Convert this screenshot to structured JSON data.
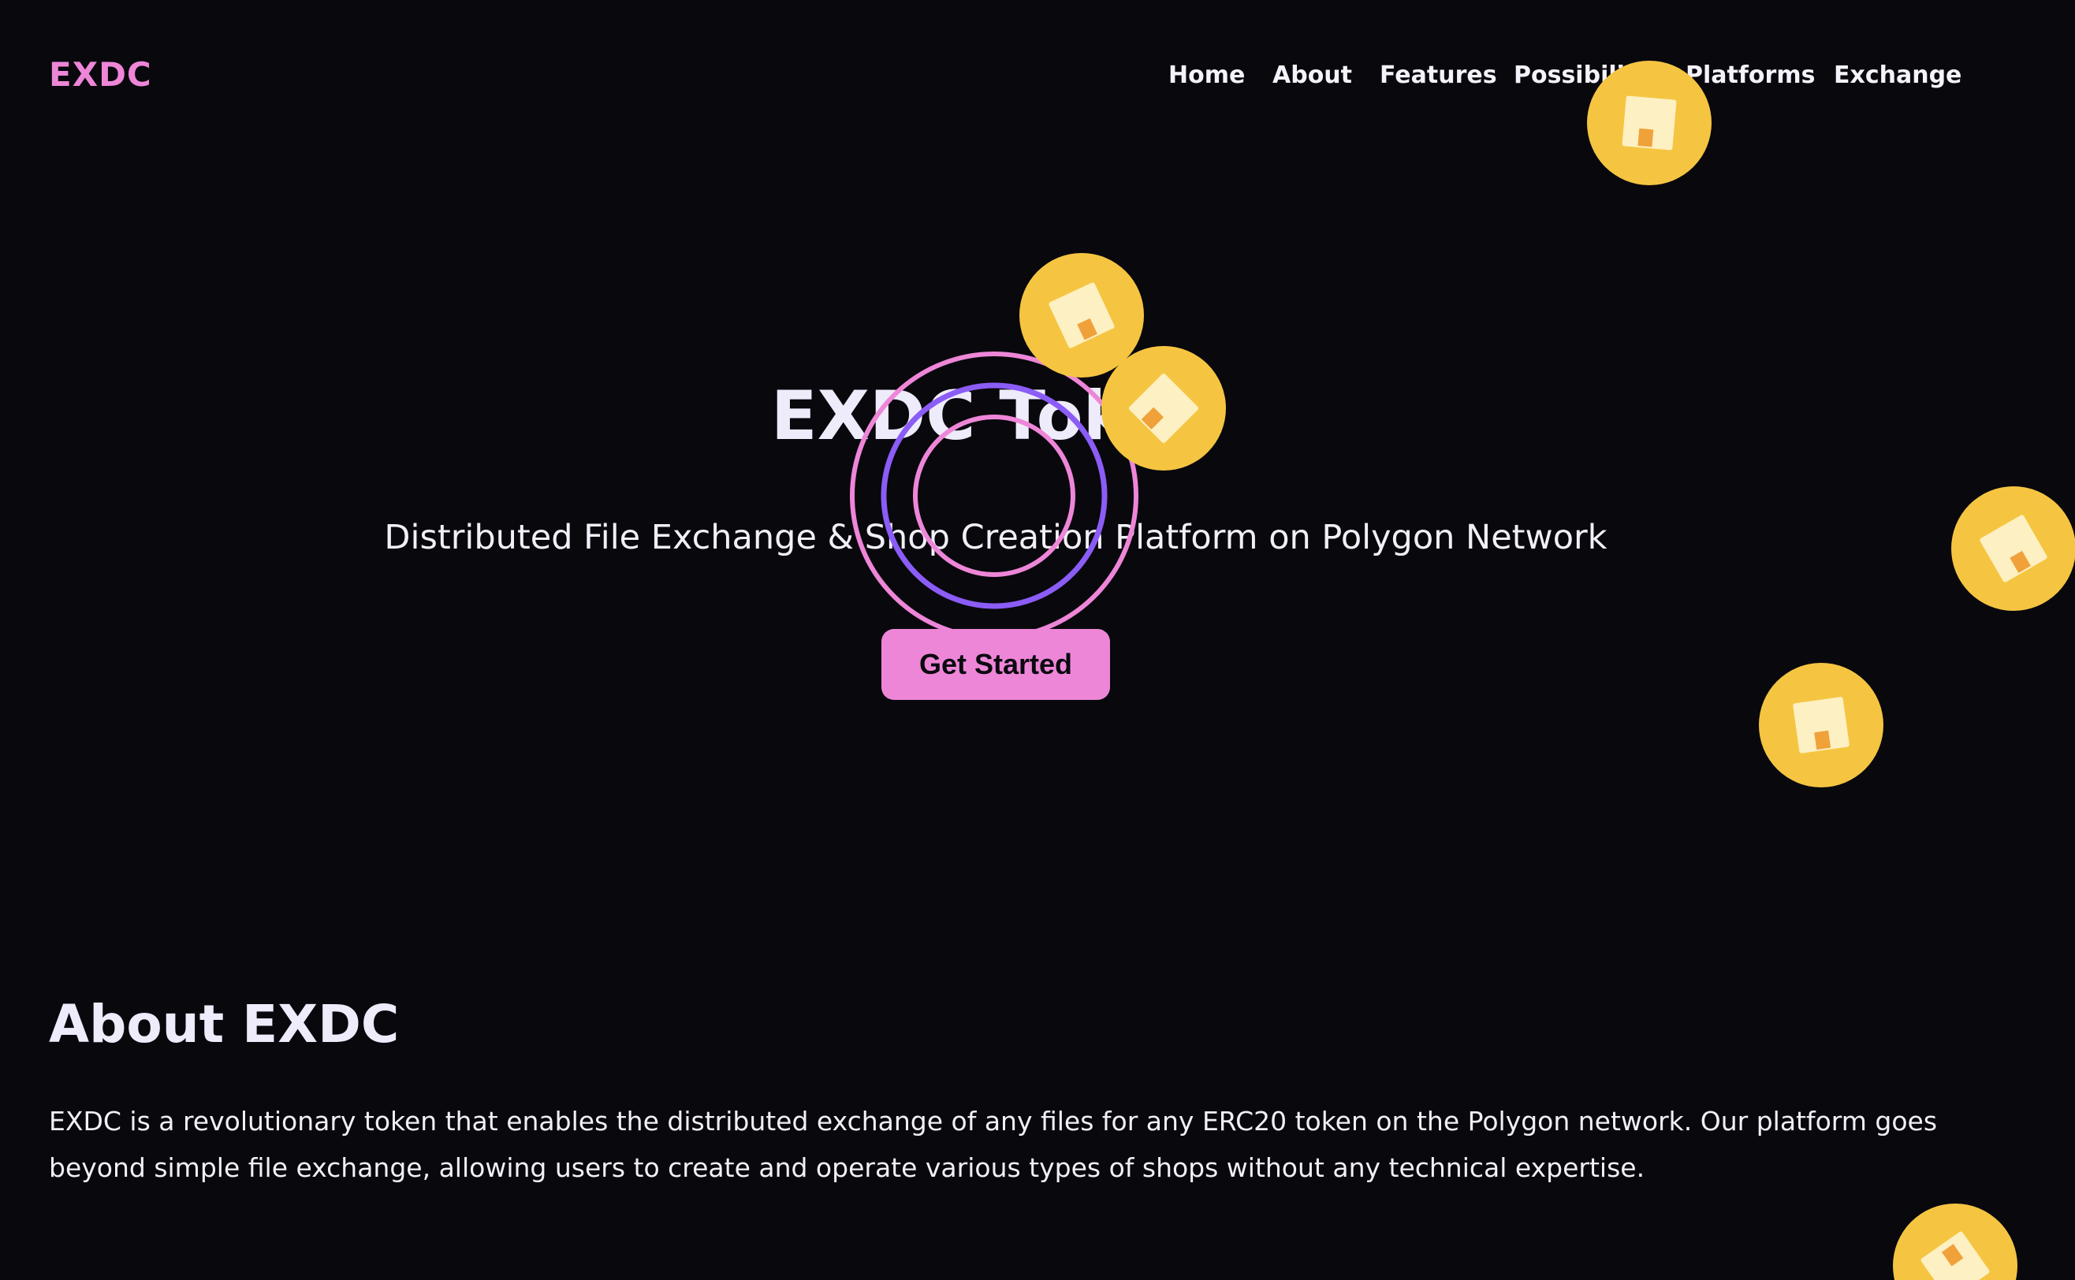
{
  "header": {
    "logo": "EXDC",
    "nav": [
      {
        "label": "Home"
      },
      {
        "label": "About"
      },
      {
        "label": "Features"
      },
      {
        "label": "Possibilities"
      },
      {
        "label": "Platforms"
      },
      {
        "label": "Exchange"
      }
    ]
  },
  "hero": {
    "title": "EXDC Token",
    "subtitle": "Distributed File Exchange & Shop Creation Platform on Polygon Network",
    "cta_label": "Get Started"
  },
  "about": {
    "title": "About EXDC",
    "text": "EXDC is a revolutionary token that enables the distributed exchange of any files for any ERC20 token on the Polygon network. Our platform goes beyond simple file exchange, allowing users to create and operate various types of shops without any technical expertise."
  },
  "decor": {
    "coin_icon": "coin-icon",
    "rings_icon": "concentric-rings-icon",
    "colors": {
      "background": "#09080d",
      "accent_pink": "#ee86d8",
      "accent_purple": "#8b5cf6",
      "coin_yellow": "#f5c542",
      "coin_inner": "#fdf0c2",
      "coin_notch": "#f0a13a"
    }
  }
}
